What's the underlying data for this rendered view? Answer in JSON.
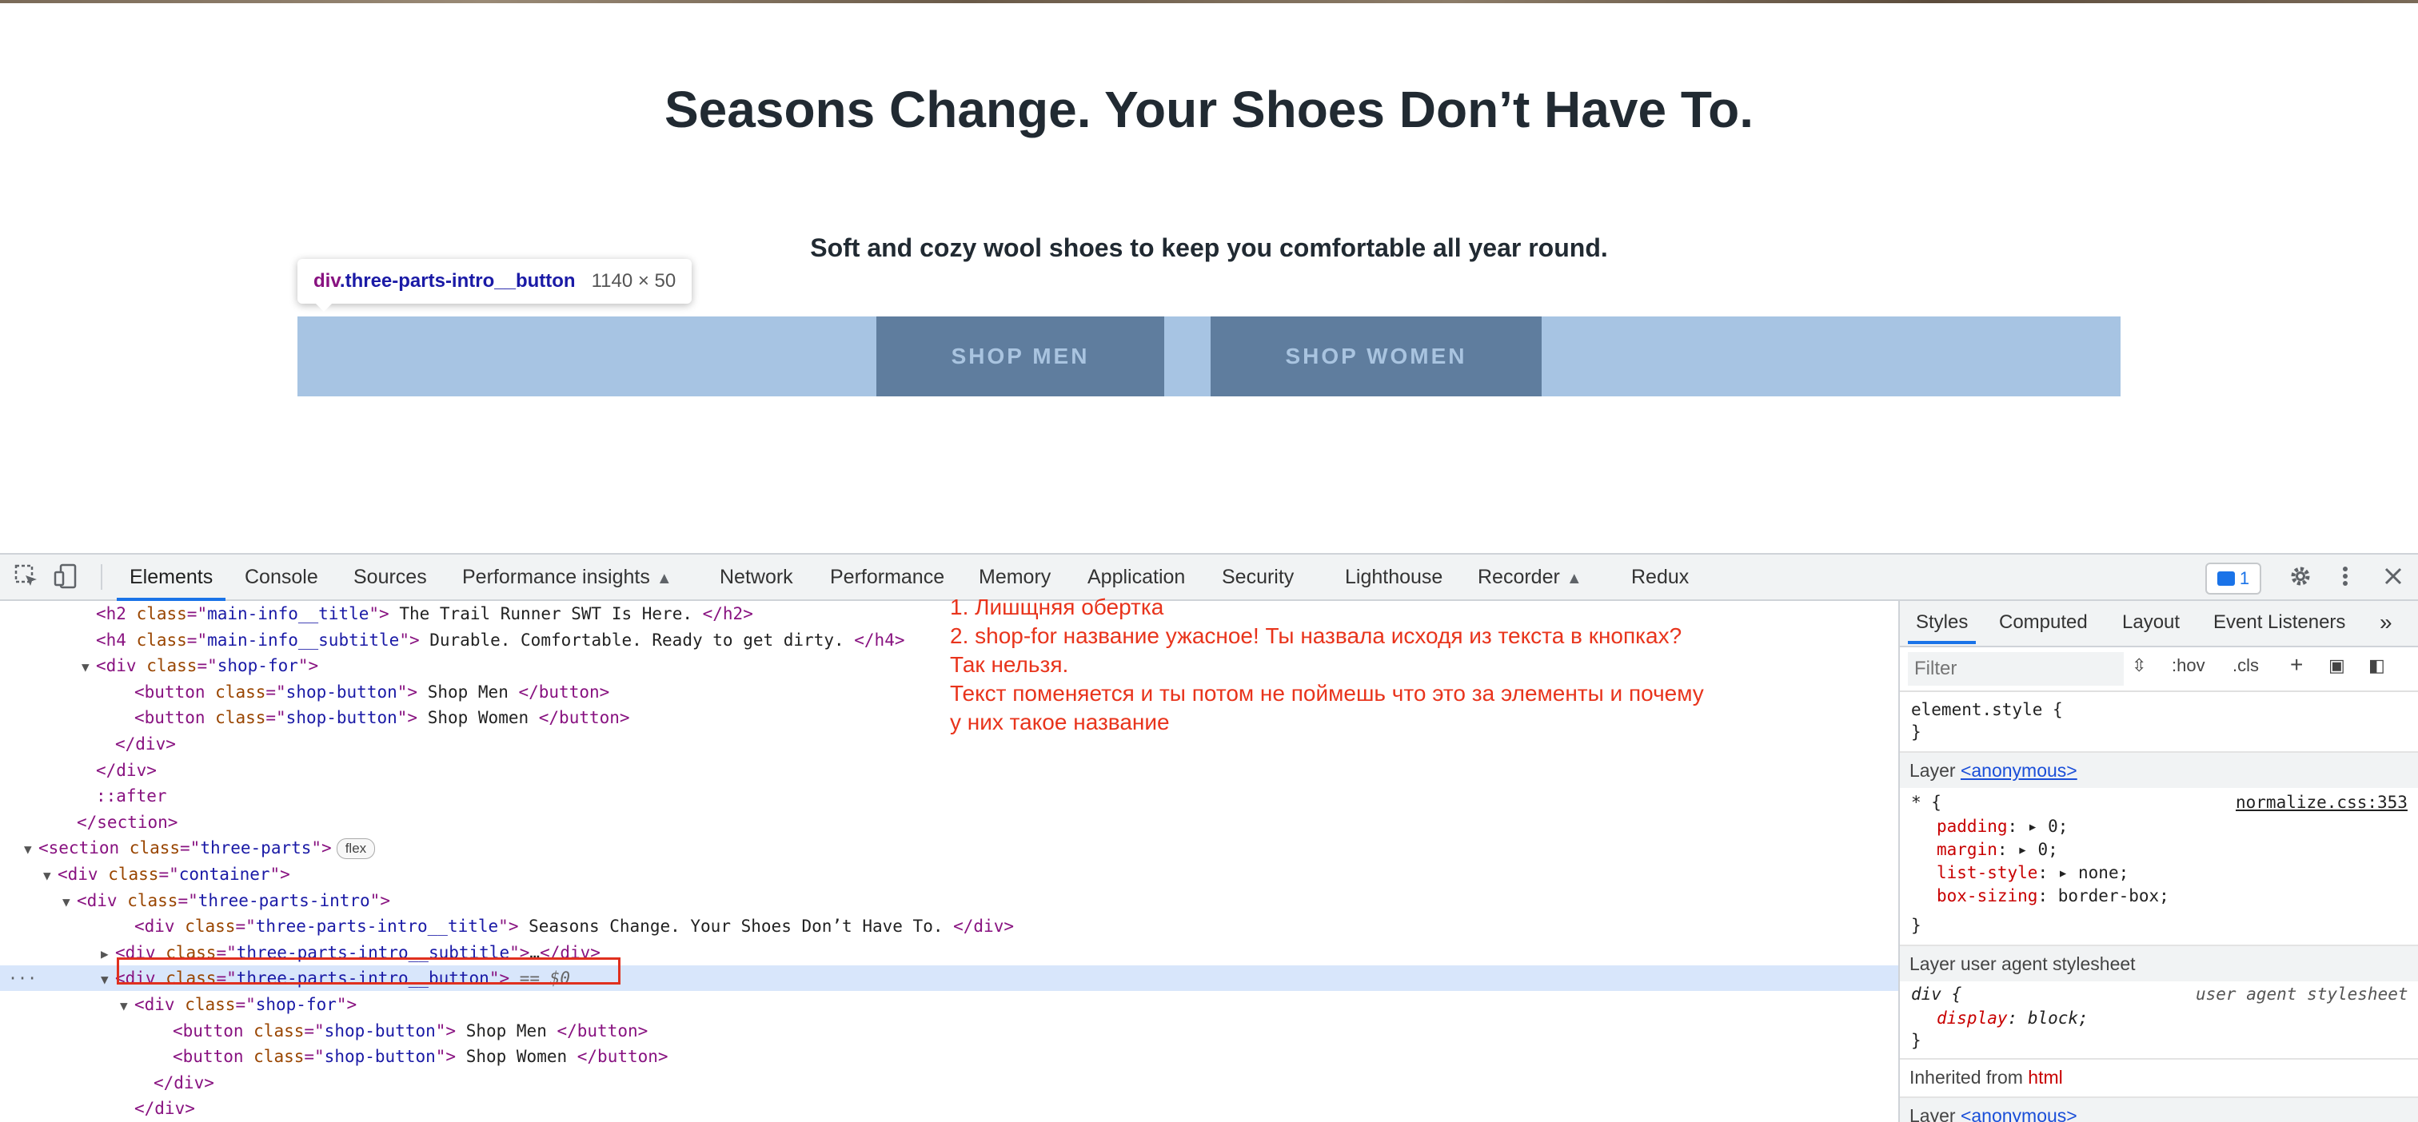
{
  "page": {
    "title": "Seasons Change. Your Shoes Don’t Have To.",
    "subtitle": "Soft and cozy wool shoes to keep you comfortable all year round.",
    "buttons": [
      "SHOP MEN",
      "SHOP WOMEN"
    ],
    "tooltip": {
      "tag": "div",
      "class": ".three-parts-intro__button",
      "size": "1140 × 50"
    }
  },
  "devtools": {
    "tabs": [
      "Elements",
      "Console",
      "Sources",
      "Performance insights",
      "Network",
      "Performance",
      "Memory",
      "Application",
      "Security",
      "Lighthouse",
      "Recorder",
      "Redux"
    ],
    "issues_count": "1",
    "dom_lines": [
      {
        "indent": 5,
        "tri": "",
        "html": [
          [
            "t",
            "<h2 "
          ],
          [
            "an",
            "class"
          ],
          [
            "t",
            "=\""
          ],
          [
            "av",
            "main-info__title"
          ],
          [
            "t",
            "\">"
          ],
          [
            "tx",
            " The Trail Runner SWT Is Here. "
          ],
          [
            "t",
            "</h2>"
          ]
        ]
      },
      {
        "indent": 5,
        "tri": "",
        "html": [
          [
            "t",
            "<h4 "
          ],
          [
            "an",
            "class"
          ],
          [
            "t",
            "=\""
          ],
          [
            "av",
            "main-info__subtitle"
          ],
          [
            "t",
            "\">"
          ],
          [
            "tx",
            " Durable. Comfortable. Ready to get dirty. "
          ],
          [
            "t",
            "</h4>"
          ]
        ]
      },
      {
        "indent": 5,
        "tri": "▼",
        "html": [
          [
            "t",
            "<div "
          ],
          [
            "an",
            "class"
          ],
          [
            "t",
            "=\""
          ],
          [
            "av",
            "shop-for"
          ],
          [
            "t",
            "\">"
          ]
        ]
      },
      {
        "indent": 7,
        "tri": "",
        "html": [
          [
            "t",
            "<button "
          ],
          [
            "an",
            "class"
          ],
          [
            "t",
            "=\""
          ],
          [
            "av",
            "shop-button"
          ],
          [
            "t",
            "\">"
          ],
          [
            "tx",
            " Shop Men "
          ],
          [
            "t",
            "</button>"
          ]
        ]
      },
      {
        "indent": 7,
        "tri": "",
        "html": [
          [
            "t",
            "<button "
          ],
          [
            "an",
            "class"
          ],
          [
            "t",
            "=\""
          ],
          [
            "av",
            "shop-button"
          ],
          [
            "t",
            "\">"
          ],
          [
            "tx",
            " Shop Women "
          ],
          [
            "t",
            "</button>"
          ]
        ]
      },
      {
        "indent": 6,
        "tri": "",
        "html": [
          [
            "t",
            "</div>"
          ]
        ]
      },
      {
        "indent": 5,
        "tri": "",
        "html": [
          [
            "t",
            "</div>"
          ]
        ]
      },
      {
        "indent": 5,
        "tri": "",
        "html": [
          [
            "ps",
            "::after"
          ]
        ]
      },
      {
        "indent": 4,
        "tri": "",
        "html": [
          [
            "t",
            "</section>"
          ]
        ]
      },
      {
        "indent": 2,
        "tri": "▼",
        "html": [
          [
            "t",
            "<section "
          ],
          [
            "an",
            "class"
          ],
          [
            "t",
            "=\""
          ],
          [
            "av",
            "three-parts"
          ],
          [
            "t",
            "\">"
          ]
        ],
        "pill": "flex"
      },
      {
        "indent": 3,
        "tri": "▼",
        "html": [
          [
            "t",
            "<div "
          ],
          [
            "an",
            "class"
          ],
          [
            "t",
            "=\""
          ],
          [
            "av",
            "container"
          ],
          [
            "t",
            "\">"
          ]
        ]
      },
      {
        "indent": 4,
        "tri": "▼",
        "html": [
          [
            "t",
            "<div "
          ],
          [
            "an",
            "class"
          ],
          [
            "t",
            "=\""
          ],
          [
            "av",
            "three-parts-intro"
          ],
          [
            "t",
            "\">"
          ]
        ]
      },
      {
        "indent": 7,
        "tri": "",
        "html": [
          [
            "t",
            "<div "
          ],
          [
            "an",
            "class"
          ],
          [
            "t",
            "=\""
          ],
          [
            "av",
            "three-parts-intro__title"
          ],
          [
            "t",
            "\">"
          ],
          [
            "tx",
            " Seasons Change. Your Shoes Don’t Have To. "
          ],
          [
            "t",
            "</div>"
          ]
        ]
      },
      {
        "indent": 6,
        "tri": "▶",
        "html": [
          [
            "t",
            "<div "
          ],
          [
            "an",
            "class"
          ],
          [
            "t",
            "=\""
          ],
          [
            "av",
            "three-parts-intro__subtitle"
          ],
          [
            "t",
            "\">"
          ],
          [
            "tx",
            "…"
          ],
          [
            "t",
            "</div>"
          ]
        ]
      },
      {
        "indent": 6,
        "tri": "▼",
        "html": [
          [
            "t",
            "<div "
          ],
          [
            "an",
            "class"
          ],
          [
            "t",
            "=\""
          ],
          [
            "av",
            "three-parts-intro__button"
          ],
          [
            "t",
            "\">"
          ]
        ],
        "selected": true,
        "suffix": " == $0"
      },
      {
        "indent": 7,
        "tri": "▼",
        "html": [
          [
            "t",
            "<div "
          ],
          [
            "an",
            "class"
          ],
          [
            "t",
            "=\""
          ],
          [
            "av",
            "shop-for"
          ],
          [
            "t",
            "\">"
          ]
        ]
      },
      {
        "indent": 9,
        "tri": "",
        "html": [
          [
            "t",
            "<button "
          ],
          [
            "an",
            "class"
          ],
          [
            "t",
            "=\""
          ],
          [
            "av",
            "shop-button"
          ],
          [
            "t",
            "\">"
          ],
          [
            "tx",
            " Shop Men "
          ],
          [
            "t",
            "</button>"
          ]
        ]
      },
      {
        "indent": 9,
        "tri": "",
        "html": [
          [
            "t",
            "<button "
          ],
          [
            "an",
            "class"
          ],
          [
            "t",
            "=\""
          ],
          [
            "av",
            "shop-button"
          ],
          [
            "t",
            "\">"
          ],
          [
            "tx",
            " Shop Women "
          ],
          [
            "t",
            "</button>"
          ]
        ]
      },
      {
        "indent": 8,
        "tri": "",
        "html": [
          [
            "t",
            "</div>"
          ]
        ]
      },
      {
        "indent": 7,
        "tri": "",
        "html": [
          [
            "t",
            "</div>"
          ]
        ]
      }
    ],
    "note_lines": [
      "1. Лишщняя обертка",
      "2. shop-for название ужасное! Ты назвала исходя из текста в кнопках?",
      "Так нельзя.",
      "Текст поменяется и ты потом не поймешь что это за элементы и почему",
      "у них такое название"
    ],
    "styles_tabs": [
      "Styles",
      "Computed",
      "Layout",
      "Event Listeners"
    ],
    "filter_placeholder": "Filter",
    "filter_buttons": [
      ":hov",
      ".cls"
    ],
    "element_style": "element.style {",
    "layer_anonymous_prefix": "Layer ",
    "layer_anonymous_link": "<anonymous>",
    "rule_selector": "* {",
    "rule_source": "normalize.css:353",
    "rule_props": [
      [
        "padding",
        "0"
      ],
      [
        "margin",
        "0"
      ],
      [
        "list-style",
        "none"
      ],
      [
        "box-sizing",
        "border-box"
      ]
    ],
    "layer_ua": "Layer user agent stylesheet",
    "ua_selector": "div {",
    "ua_source": "user agent stylesheet",
    "ua_prop": [
      "display",
      "block"
    ],
    "inherited_prefix": "Inherited from ",
    "inherited_tag": "html",
    "close_brace": "}"
  }
}
